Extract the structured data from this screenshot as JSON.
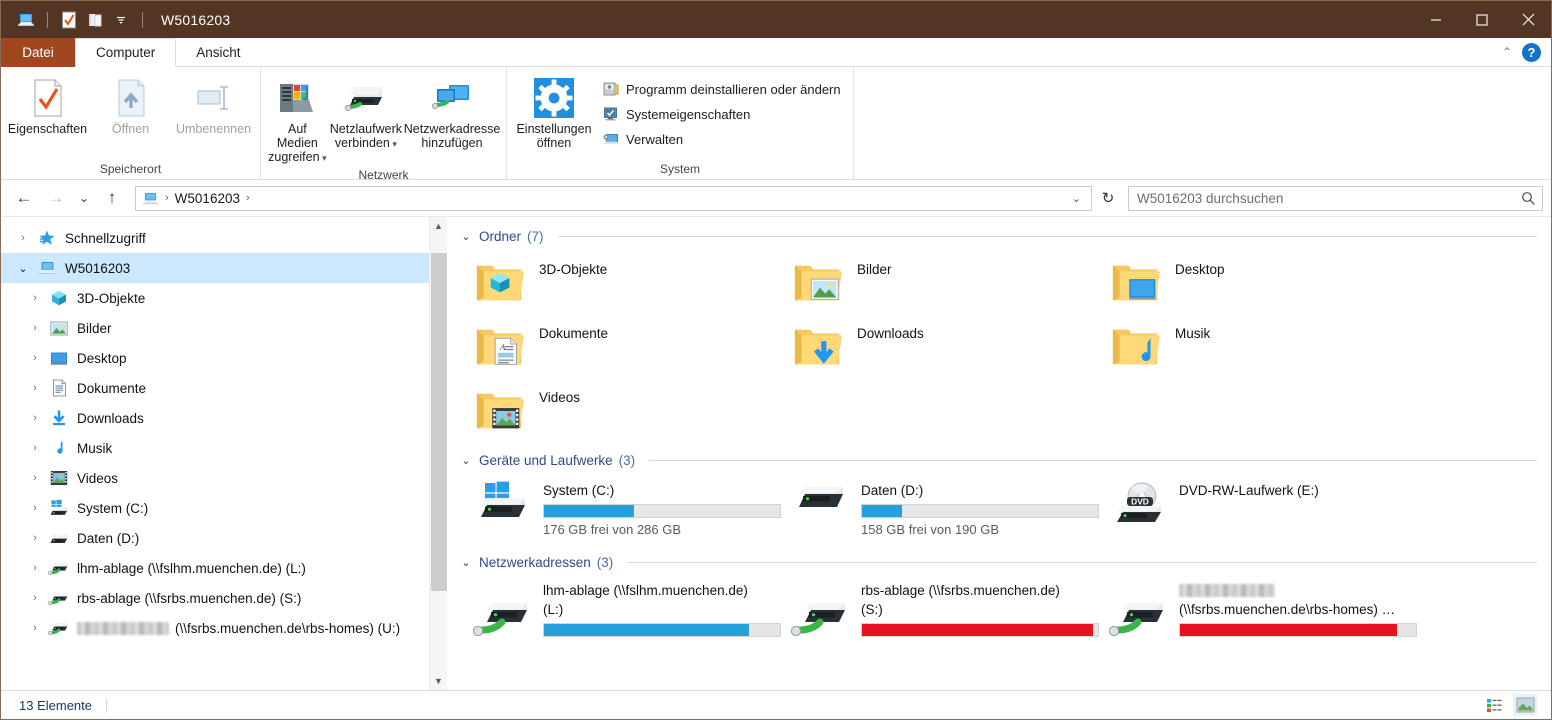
{
  "window": {
    "title": "W5016203",
    "titlebar_color": "#533524",
    "quick_access": [
      {
        "name": "this-pc-icon",
        "label": "Dieser PC"
      },
      {
        "name": "properties-icon",
        "label": "Eigenschaften"
      },
      {
        "name": "new-folder-icon",
        "label": "Neuer Ordner"
      },
      {
        "name": "customize-qat-icon",
        "label": "Symbolleiste für den Schnellzugriff anpassen"
      }
    ],
    "controls": [
      {
        "name": "minimize-button",
        "label": "Minimieren"
      },
      {
        "name": "maximize-button",
        "label": "Maximieren"
      },
      {
        "name": "close-button",
        "label": "Schließen"
      }
    ]
  },
  "tabs": [
    {
      "label": "Datei",
      "name": "tab-datei",
      "style": "file"
    },
    {
      "label": "Computer",
      "name": "tab-computer",
      "style": "active"
    },
    {
      "label": "Ansicht",
      "name": "tab-ansicht",
      "style": "normal"
    }
  ],
  "tabbar_right": {
    "collapse_label": "⌃",
    "help_label": "?"
  },
  "ribbon": {
    "groups": [
      {
        "title": "Speicherort",
        "name": "ribbon-group-speicherort",
        "buttons": [
          {
            "label_line1": "Eigenschaften",
            "label_line2": "",
            "name": "eigenschaften-button",
            "icon": "properties-page-icon",
            "disabled": false,
            "dropdown": false
          },
          {
            "label_line1": "Öffnen",
            "label_line2": "",
            "name": "oeffnen-button",
            "icon": "open-arrow-icon",
            "disabled": true,
            "dropdown": false
          },
          {
            "label_line1": "Umbenennen",
            "label_line2": "",
            "name": "umbenennen-button",
            "icon": "rename-icon",
            "disabled": true,
            "dropdown": false
          }
        ]
      },
      {
        "title": "Netzwerk",
        "name": "ribbon-group-netzwerk",
        "buttons": [
          {
            "label_line1": "Auf Medien",
            "label_line2": "zugreifen",
            "name": "auf-medien-zugreifen-button",
            "icon": "media-server-icon",
            "disabled": false,
            "dropdown": true
          },
          {
            "label_line1": "Netzlaufwerk",
            "label_line2": "verbinden",
            "name": "netzlaufwerk-verbinden-button",
            "icon": "map-network-drive-icon",
            "disabled": false,
            "dropdown": true
          },
          {
            "label_line1": "Netzwerkadresse",
            "label_line2": "hinzufügen",
            "name": "netzwerkadresse-hinzufuegen-button",
            "icon": "add-network-location-icon",
            "disabled": false,
            "dropdown": false
          }
        ]
      },
      {
        "title": "System",
        "name": "ribbon-group-system",
        "big": {
          "label_line1": "Einstellungen",
          "label_line2": "öffnen",
          "name": "einstellungen-oeffnen-button",
          "icon": "settings-gear-icon"
        },
        "items": [
          {
            "label": "Programm deinstallieren oder ändern",
            "name": "programm-deinstallieren-button",
            "icon": "uninstall-program-icon"
          },
          {
            "label": "Systemeigenschaften",
            "name": "systemeigenschaften-button",
            "icon": "system-properties-icon"
          },
          {
            "label": "Verwalten",
            "name": "verwalten-button",
            "icon": "manage-computer-icon"
          }
        ]
      }
    ]
  },
  "addressbar": {
    "back_label": "←",
    "forward_label": "→",
    "recent_label": "⌄",
    "up_label": "↑",
    "crumb_icon": "this-pc-icon",
    "crumbs": [
      "W5016203"
    ],
    "crumb_separator": "›",
    "dropdown_label": "⌄",
    "refresh_label": "↻",
    "search_placeholder": "W5016203 durchsuchen",
    "search_value": "",
    "search_icon": "search-icon"
  },
  "sidebar": {
    "items": [
      {
        "label": "Schnellzugriff",
        "name": "tree-item-schnellzugriff",
        "icon": "quick-access-star-icon",
        "level": 1,
        "expanded": false,
        "selected": false
      },
      {
        "label": "W5016203",
        "name": "tree-item-w5016203",
        "icon": "this-pc-icon",
        "level": 1,
        "expanded": true,
        "selected": true
      },
      {
        "label": "3D-Objekte",
        "name": "tree-item-3d-objekte",
        "icon": "3d-objects-icon",
        "level": 2,
        "expanded": false,
        "selected": false
      },
      {
        "label": "Bilder",
        "name": "tree-item-bilder",
        "icon": "pictures-icon",
        "level": 2,
        "expanded": false,
        "selected": false
      },
      {
        "label": "Desktop",
        "name": "tree-item-desktop",
        "icon": "desktop-icon",
        "level": 2,
        "expanded": false,
        "selected": false
      },
      {
        "label": "Dokumente",
        "name": "tree-item-dokumente",
        "icon": "documents-icon",
        "level": 2,
        "expanded": false,
        "selected": false
      },
      {
        "label": "Downloads",
        "name": "tree-item-downloads",
        "icon": "downloads-icon",
        "level": 2,
        "expanded": false,
        "selected": false
      },
      {
        "label": "Musik",
        "name": "tree-item-musik",
        "icon": "music-icon",
        "level": 2,
        "expanded": false,
        "selected": false
      },
      {
        "label": "Videos",
        "name": "tree-item-videos",
        "icon": "videos-icon",
        "level": 2,
        "expanded": false,
        "selected": false
      },
      {
        "label": "System (C:)",
        "name": "tree-item-system-c",
        "icon": "windows-drive-icon",
        "level": 2,
        "expanded": false,
        "selected": false
      },
      {
        "label": "Daten (D:)",
        "name": "tree-item-daten-d",
        "icon": "hard-drive-icon",
        "level": 2,
        "expanded": false,
        "selected": false
      },
      {
        "label": "lhm-ablage (\\\\fslhm.muenchen.de) (L:)",
        "name": "tree-item-lhm-ablage-l",
        "icon": "network-drive-icon",
        "level": 2,
        "expanded": false,
        "selected": false
      },
      {
        "label": "rbs-ablage (\\\\fsrbs.muenchen.de) (S:)",
        "name": "tree-item-rbs-ablage-s",
        "icon": "network-drive-icon",
        "level": 2,
        "expanded": false,
        "selected": false
      },
      {
        "label": "(\\\\fsrbs.muenchen.de\\rbs-homes) (U:)",
        "name": "tree-item-rbs-homes-u",
        "icon": "network-drive-icon",
        "level": 2,
        "expanded": false,
        "selected": false,
        "redacted_prefix": true
      }
    ]
  },
  "content": {
    "groups": [
      {
        "label": "Ordner",
        "count": "(7)",
        "name": "group-ordner",
        "expanded": true,
        "kind": "folders",
        "items": [
          {
            "label": "3D-Objekte",
            "name": "folder-3d-objekte",
            "icon": "folder-3d-objects-icon"
          },
          {
            "label": "Bilder",
            "name": "folder-bilder",
            "icon": "folder-pictures-icon"
          },
          {
            "label": "Desktop",
            "name": "folder-desktop",
            "icon": "folder-desktop-icon"
          },
          {
            "label": "Dokumente",
            "name": "folder-dokumente",
            "icon": "folder-documents-icon"
          },
          {
            "label": "Downloads",
            "name": "folder-downloads",
            "icon": "folder-downloads-icon"
          },
          {
            "label": "Musik",
            "name": "folder-musik",
            "icon": "folder-music-icon"
          },
          {
            "label": "Videos",
            "name": "folder-videos",
            "icon": "folder-videos-icon"
          }
        ]
      },
      {
        "label": "Geräte und Laufwerke",
        "count": "(3)",
        "name": "group-geraete-und-laufwerke",
        "expanded": true,
        "kind": "drives",
        "items": [
          {
            "label": "System (C:)",
            "name": "drive-system-c",
            "icon": "windows-drive-icon",
            "sub": "176 GB frei von 286 GB",
            "used_percent": 38,
            "bar_color": "#26a0da",
            "has_bar": true
          },
          {
            "label": "Daten (D:)",
            "name": "drive-daten-d",
            "icon": "hard-drive-icon",
            "sub": "158 GB frei von 190 GB",
            "used_percent": 17,
            "bar_color": "#26a0da",
            "has_bar": true
          },
          {
            "label": "DVD-RW-Laufwerk (E:)",
            "name": "drive-dvd-rw-e",
            "icon": "dvd-drive-icon",
            "sub": "",
            "used_percent": 0,
            "bar_color": "#26a0da",
            "has_bar": false
          }
        ]
      },
      {
        "label": "Netzwerkadressen",
        "count": "(3)",
        "name": "group-netzwerkadressen",
        "expanded": true,
        "kind": "network",
        "items": [
          {
            "label_line1": "lhm-ablage (\\\\fslhm.muenchen.de)",
            "label_line2": "(L:)",
            "name": "network-drive-lhm-ablage-l",
            "icon": "network-drive-icon",
            "used_percent": 87,
            "bar_color": "#26a0da",
            "has_bar": true,
            "redacted": false
          },
          {
            "label_line1": "rbs-ablage (\\\\fsrbs.muenchen.de)",
            "label_line2": "(S:)",
            "name": "network-drive-rbs-ablage-s",
            "icon": "network-drive-icon",
            "used_percent": 98,
            "bar_color": "#e81123",
            "has_bar": true,
            "redacted": false
          },
          {
            "label_line1": "",
            "label_line2": "(\\\\fsrbs.muenchen.de\\rbs-homes) …",
            "name": "network-drive-rbs-homes-u",
            "icon": "network-drive-icon",
            "used_percent": 92,
            "bar_color": "#e81123",
            "has_bar": true,
            "redacted": true
          }
        ]
      }
    ]
  },
  "statusbar": {
    "item_count": "13 Elemente",
    "view_buttons": [
      {
        "name": "details-view-button",
        "label": "Details",
        "active": false
      },
      {
        "name": "large-icons-view-button",
        "label": "Große Symbole",
        "active": true
      }
    ]
  }
}
